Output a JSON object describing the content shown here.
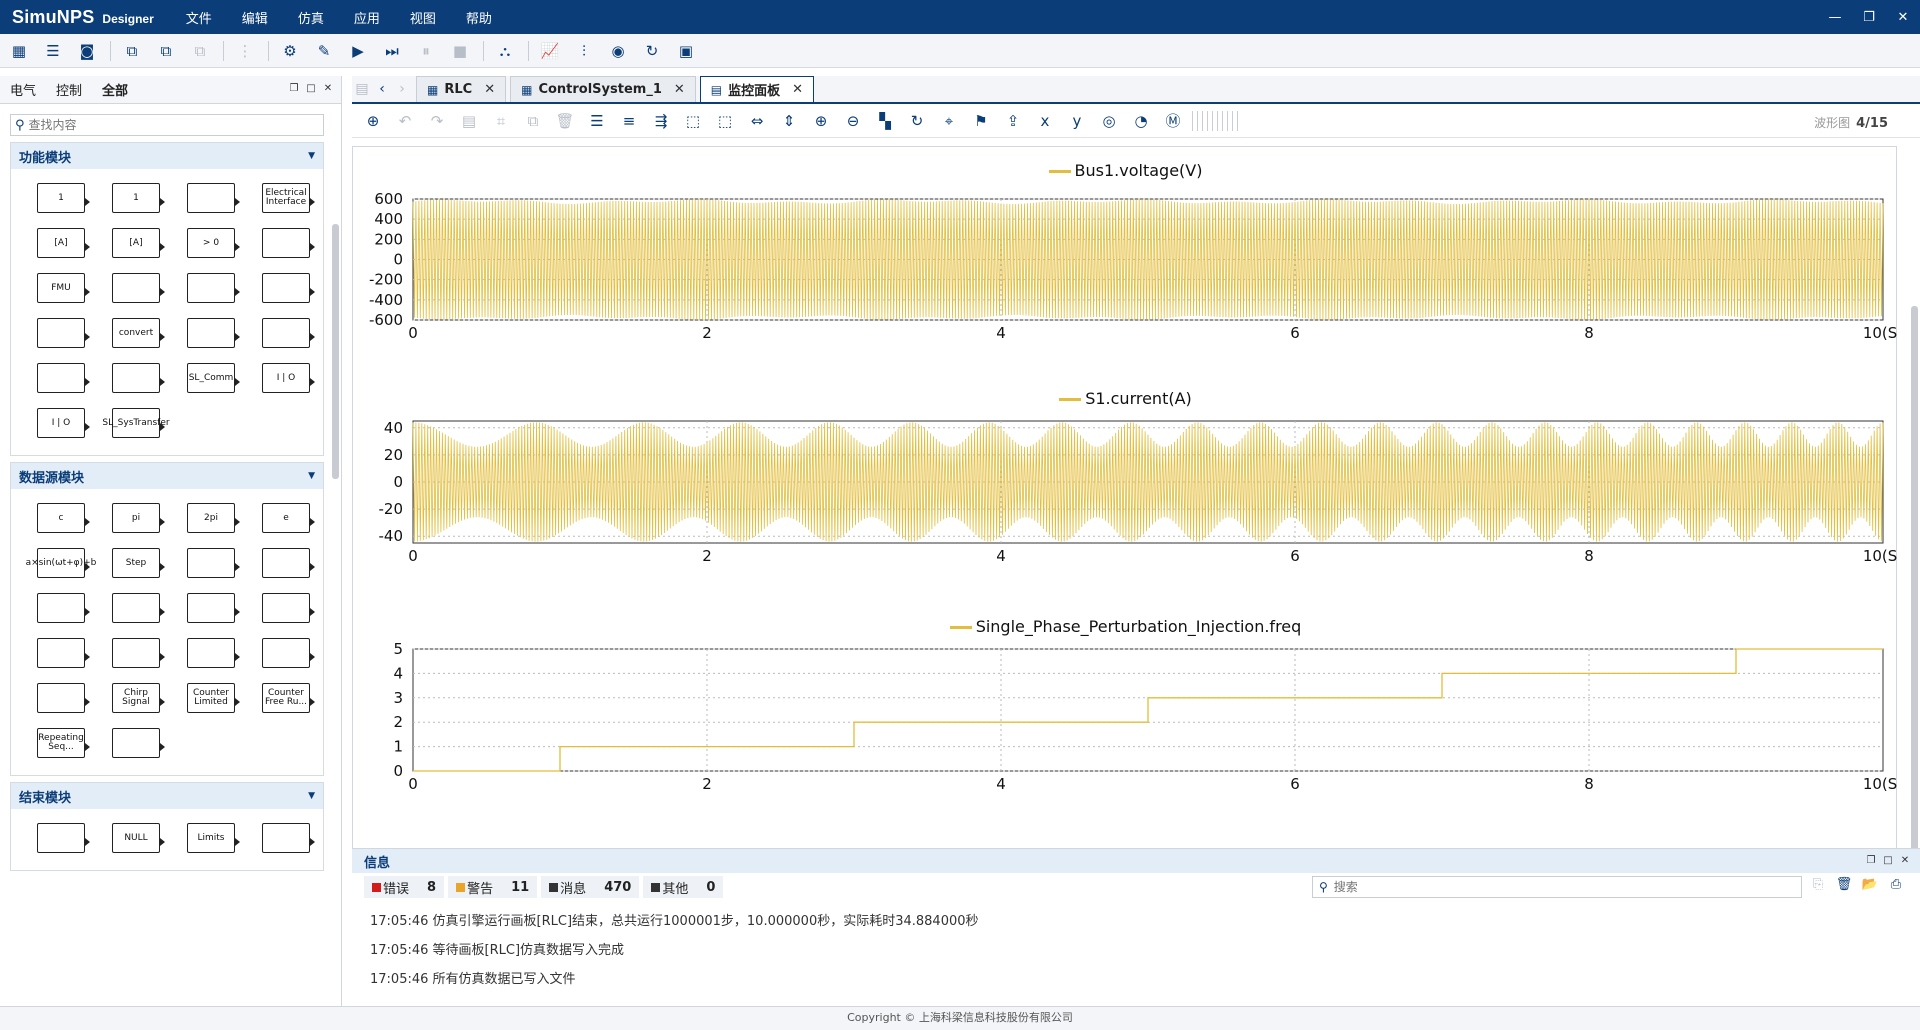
{
  "app": {
    "name": "SimuNPS",
    "subtitle": "Designer"
  },
  "menu": [
    "文件",
    "编辑",
    "仿真",
    "应用",
    "视图",
    "帮助"
  ],
  "window_controls": [
    "—",
    "❐",
    "✕"
  ],
  "toolbar": {
    "icons": [
      "grid-icon",
      "list-icon",
      "save-icon",
      "sep",
      "copy-new-icon",
      "copy-gear-icon",
      "copy-disabled-icon",
      "sep",
      "align-disabled-icon",
      "sep",
      "settings-icon",
      "edit-icon",
      "play-icon",
      "step-icon",
      "pause-disabled-icon",
      "stop-disabled-icon",
      "sep",
      "network-icon",
      "sep",
      "chart-icon",
      "sliders-icon",
      "monitor-icon",
      "loop-icon",
      "chip-icon"
    ]
  },
  "library": {
    "tabs": [
      "电气",
      "控制",
      "全部"
    ],
    "search_placeholder": "查找内容",
    "sections": [
      {
        "title": "功能模块",
        "blocks": [
          "1",
          "1",
          "",
          "Electrical Interface",
          "[A]",
          "[A]",
          "> 0",
          "",
          "FMU",
          "",
          "",
          "",
          "",
          "convert",
          "",
          "",
          "",
          "",
          "SL_Comm",
          "I | O",
          "I | O",
          "SL_SysTransfer"
        ]
      },
      {
        "title": "数据源模块",
        "blocks": [
          "c",
          "pi",
          "2pi",
          "e",
          "a×sin(ωt+φ)+b",
          "Step",
          "",
          "",
          "",
          "",
          "",
          "",
          "",
          "",
          "",
          "",
          "",
          "Chirp Signal",
          "Counter Limited",
          "Counter Free Ru...",
          "Repeating Seq...",
          ""
        ]
      },
      {
        "title": "结束模块",
        "blocks": [
          "",
          "NULL",
          "Limits",
          ""
        ]
      }
    ]
  },
  "tabs": [
    {
      "label": "RLC",
      "icon": "▦"
    },
    {
      "label": "ControlSystem_1",
      "icon": "▦"
    },
    {
      "label": "监控面板",
      "icon": "▤"
    }
  ],
  "active_tab": 2,
  "plot_tools_count": {
    "label": "波形图",
    "value": "4/15"
  },
  "plots": [
    {
      "title": "Bus1.voltage(V)",
      "yticks": [
        "600",
        "400",
        "200",
        "0",
        "-200",
        "-400",
        "-600"
      ],
      "xticks": [
        "0",
        "2",
        "4",
        "6",
        "8",
        "10(S)"
      ]
    },
    {
      "title": "S1.current(A)",
      "yticks": [
        "40",
        "20",
        "0",
        "-20",
        "-40"
      ],
      "xticks": [
        "0",
        "2",
        "4",
        "6",
        "8",
        "10(S)"
      ]
    },
    {
      "title": "Single_Phase_Perturbation_Injection.freq",
      "yticks": [
        "5",
        "4",
        "3",
        "2",
        "1",
        "0"
      ],
      "xticks": [
        "0",
        "2",
        "4",
        "6",
        "8",
        "10(S)"
      ]
    }
  ],
  "chart_data": [
    {
      "type": "line",
      "title": "",
      "series": [
        {
          "name": "Bus1.voltage(V)",
          "shape": "sinusoid",
          "amplitude_min": 550,
          "amplitude_max": 600
        }
      ],
      "x_range": [
        0,
        10
      ],
      "ylim": [
        -600,
        600
      ],
      "xlabel": "",
      "ylabel": "",
      "grid": true,
      "legend": "top-center",
      "colors": {
        "series": "#e3be3c"
      }
    },
    {
      "type": "line",
      "title": "",
      "series": [
        {
          "name": "S1.current(A)",
          "shape": "beating sinusoid",
          "envelope_min": 26,
          "envelope_max": 44,
          "beat_count": 22
        }
      ],
      "x_range": [
        0,
        10
      ],
      "ylim": [
        -45,
        45
      ],
      "xlabel": "",
      "ylabel": "",
      "grid": true,
      "legend": "top-center"
    },
    {
      "type": "line",
      "title": "",
      "series": [
        {
          "name": "Single_Phase_Perturbation_Injection.freq",
          "x": [
            0,
            1,
            1,
            3,
            3,
            5,
            5,
            7,
            7,
            9,
            9,
            10
          ],
          "y": [
            0,
            0,
            1,
            1,
            2,
            2,
            3,
            3,
            4,
            4,
            5,
            5
          ]
        }
      ],
      "x_range": [
        0,
        10
      ],
      "ylim": [
        0,
        5
      ],
      "xlabel": "",
      "ylabel": "",
      "grid": true,
      "legend": "top-center"
    }
  ],
  "info": {
    "title": "信息",
    "counters": [
      {
        "label": "错误",
        "value": "8",
        "color": "#d41b1b"
      },
      {
        "label": "警告",
        "value": "11",
        "color": "#e8a52a"
      },
      {
        "label": "消息",
        "value": "470",
        "color": "#333333"
      },
      {
        "label": "其他",
        "value": "0",
        "color": "#333333"
      }
    ],
    "search_placeholder": "搜索",
    "logs": [
      "17:05:46 仿真引擎运行画板[RLC]结束，总共运行1000001步，10.000000秒，实际耗时34.884000秒",
      "17:05:46 等待画板[RLC]仿真数据写入完成",
      "17:05:46 所有仿真数据已写入文件"
    ]
  },
  "footer": "Copyright © 上海科梁信息科技股份有限公司"
}
